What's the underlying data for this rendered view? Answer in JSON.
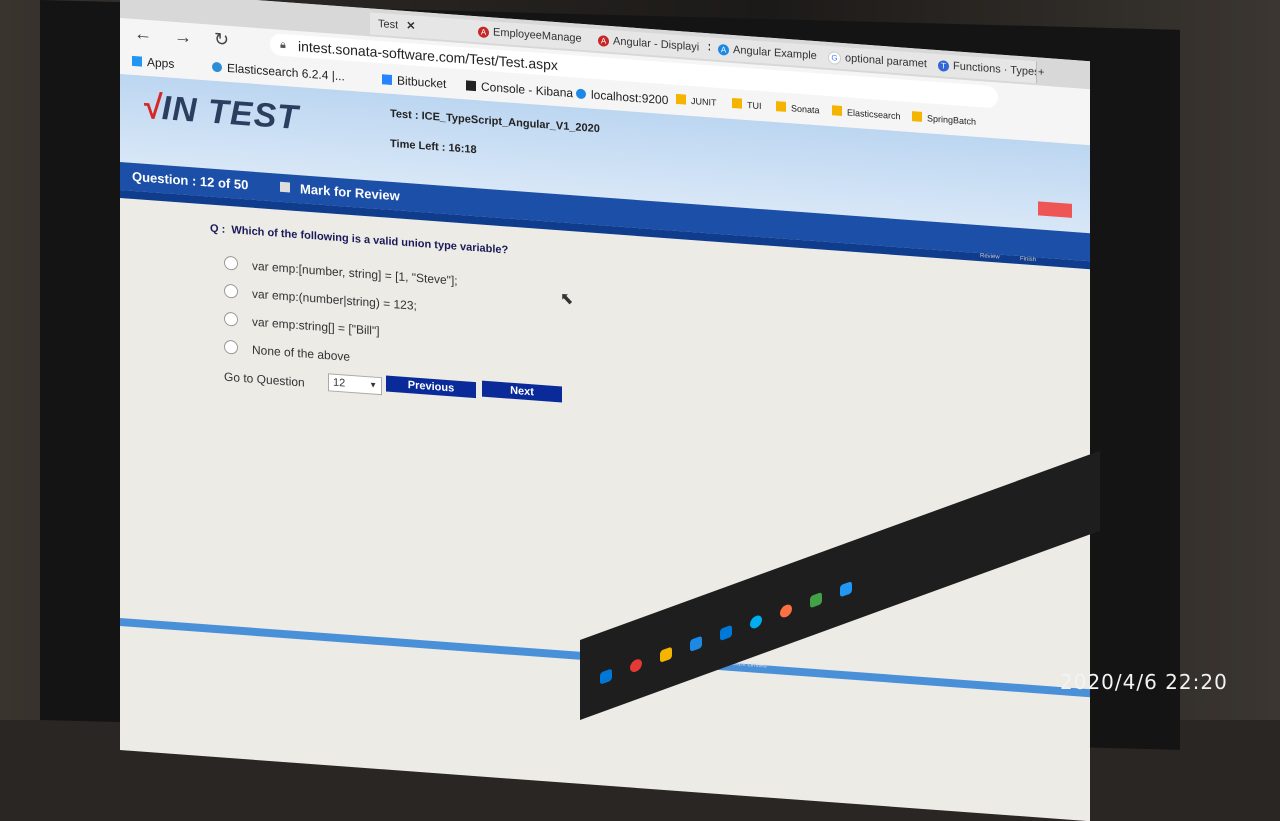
{
  "browser": {
    "tabs": [
      {
        "label": "Test",
        "icon": "page-icon"
      },
      {
        "label": "EmployeeManage",
        "icon": "angular-icon"
      },
      {
        "label": "Angular - Displayi",
        "icon": "angular-icon"
      },
      {
        "label": "Angular Example",
        "icon": "angular-icon"
      },
      {
        "label": "optional paramet",
        "icon": "google-icon"
      },
      {
        "label": "Functions · Types",
        "icon": "page-icon"
      }
    ],
    "url": "intest.sonata-software.com/Test/Test.aspx",
    "bookmarks": [
      {
        "label": "Apps",
        "color": "#2196f3"
      },
      {
        "label": "Elasticsearch 6.2.4 |...",
        "color": "#2b8fd6"
      },
      {
        "label": "Bitbucket",
        "color": "#2684ff"
      },
      {
        "label": "Console - Kibana",
        "color": "#222222"
      },
      {
        "label": "localhost:9200",
        "color": "#1e88e5"
      },
      {
        "label": "JUNIT",
        "color": "#f4b400"
      },
      {
        "label": "TUI",
        "color": "#f4b400"
      },
      {
        "label": "Sonata",
        "color": "#f4b400"
      },
      {
        "label": "Elasticsearch",
        "color": "#f4b400"
      },
      {
        "label": "SpringBatch",
        "color": "#f4b400"
      }
    ]
  },
  "app": {
    "logo_mark": "√",
    "logo_text": "IN TEST",
    "test_name": "Test : ICE_TypeScript_Angular_V1_2020",
    "time_left": "Time Left : 16:18",
    "question_counter": "Question : 12 of 50",
    "mark_for_review": "Mark for Review",
    "subbar": {
      "review": "Review",
      "finish": "Finish"
    }
  },
  "question": {
    "prefix": "Q :",
    "text": "Which of the following is a valid union type variable?",
    "options": [
      "var emp:[number, string] = [1, \"Steve\"];",
      "var emp:(number|string) = 123;",
      "var emp:string[] = [\"Bill\"]",
      "None of the above"
    ],
    "goto_label": "Go to Question",
    "goto_value": "12",
    "prev_label": "Previous",
    "next_label": "Next"
  },
  "footer": {
    "text": "InTest - Sonata Software Limited"
  },
  "photo_timestamp": "2020/4/6  22:20",
  "colors": {
    "header_blue": "#1b4fa8",
    "button_navy": "#0a2a9a",
    "logo_red": "#d62828"
  }
}
